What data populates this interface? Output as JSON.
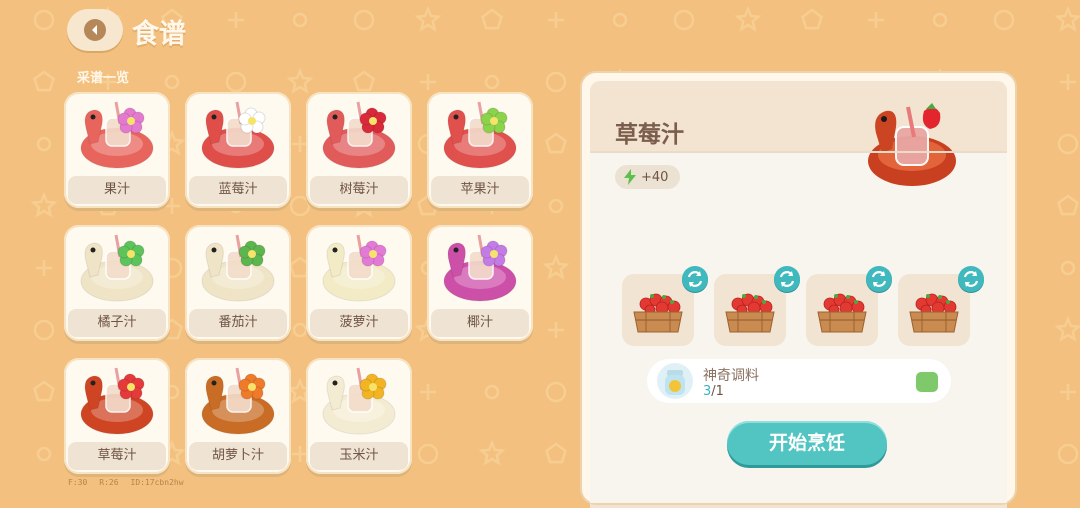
{
  "header": {
    "title": "食谱",
    "back_icon": "chevron-left-icon"
  },
  "section_label": "采谱一览",
  "recipes": [
    {
      "name": "果汁",
      "ring": "#e8655d",
      "flower": "#e37ad0"
    },
    {
      "name": "蓝莓汁",
      "ring": "#e04e4a",
      "flower": "#ffffff"
    },
    {
      "name": "树莓汁",
      "ring": "#e25b5b",
      "flower": "#d92a39"
    },
    {
      "name": "苹果汁",
      "ring": "#e0504c",
      "flower": "#8bd34b"
    },
    {
      "name": "橘子汁",
      "ring": "#f0e4c6",
      "flower": "#5cc45a"
    },
    {
      "name": "番茄汁",
      "ring": "#f0e4c6",
      "flower": "#5cb54e"
    },
    {
      "name": "菠萝汁",
      "ring": "#f2ebc6",
      "flower": "#e27ad6"
    },
    {
      "name": "椰汁",
      "ring": "#cc4fa8",
      "flower": "#c37be6"
    },
    {
      "name": "草莓汁",
      "ring": "#cf4524",
      "flower": "#e43a3a"
    },
    {
      "name": "胡萝卜汁",
      "ring": "#c96c25",
      "flower": "#ee7a2a"
    },
    {
      "name": "玉米汁",
      "ring": "#f4ecd2",
      "flower": "#f2b420"
    }
  ],
  "detail": {
    "title": "草莓汁",
    "energy": "+40",
    "ingredient_count": 4,
    "seasoning_label": "神奇调料",
    "seasoning_have": "3",
    "seasoning_need": "/1",
    "cook_button": "开始烹饪"
  },
  "debug": {
    "f": "F:30",
    "r": "R:26",
    "id": "ID:17cbn2hw"
  },
  "colors": {
    "background": "#f3c07f",
    "accent": "#52c4c2",
    "text": "#6f5443"
  }
}
